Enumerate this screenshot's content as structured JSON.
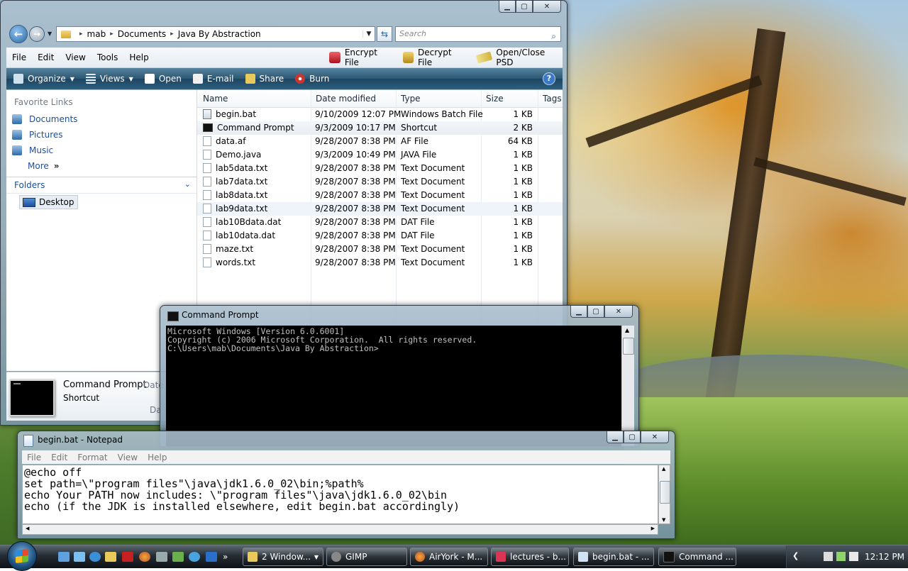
{
  "explorer": {
    "breadcrumb": [
      "mab",
      "Documents",
      "Java By Abstraction"
    ],
    "search_placeholder": "Search",
    "menu": [
      "File",
      "Edit",
      "View",
      "Tools",
      "Help"
    ],
    "tools": [
      "Encrypt File",
      "Decrypt File",
      "Open/Close PSD"
    ],
    "commands": [
      "Organize",
      "Views",
      "Open",
      "E-mail",
      "Share",
      "Burn"
    ],
    "favorites_title": "Favorite Links",
    "favorites": [
      "Documents",
      "Pictures",
      "Music"
    ],
    "more_label": "More",
    "more_glyph": "»",
    "folders_label": "Folders",
    "tree_item": "Desktop",
    "columns": [
      "Name",
      "Date modified",
      "Type",
      "Size",
      "Tags"
    ],
    "files": [
      {
        "name": "begin.bat",
        "date": "9/10/2009 12:07 PM",
        "type": "Windows Batch File",
        "size": "1 KB"
      },
      {
        "name": "Command Prompt",
        "date": "9/3/2009 10:17 PM",
        "type": "Shortcut",
        "size": "2 KB"
      },
      {
        "name": "data.af",
        "date": "9/28/2007 8:38 PM",
        "type": "AF File",
        "size": "64 KB"
      },
      {
        "name": "Demo.java",
        "date": "9/3/2009 10:49 PM",
        "type": "JAVA File",
        "size": "1 KB"
      },
      {
        "name": "lab5data.txt",
        "date": "9/28/2007 8:38 PM",
        "type": "Text Document",
        "size": "1 KB"
      },
      {
        "name": "lab7data.txt",
        "date": "9/28/2007 8:38 PM",
        "type": "Text Document",
        "size": "1 KB"
      },
      {
        "name": "lab8data.txt",
        "date": "9/28/2007 8:38 PM",
        "type": "Text Document",
        "size": "1 KB"
      },
      {
        "name": "lab9data.txt",
        "date": "9/28/2007 8:38 PM",
        "type": "Text Document",
        "size": "1 KB"
      },
      {
        "name": "lab10Bdata.dat",
        "date": "9/28/2007 8:38 PM",
        "type": "DAT File",
        "size": "1 KB"
      },
      {
        "name": "lab10data.dat",
        "date": "9/28/2007 8:38 PM",
        "type": "DAT File",
        "size": "1 KB"
      },
      {
        "name": "maze.txt",
        "date": "9/28/2007 8:38 PM",
        "type": "Text Document",
        "size": "1 KB"
      },
      {
        "name": "words.txt",
        "date": "9/28/2007 8:38 PM",
        "type": "Text Document",
        "size": "1 KB"
      }
    ],
    "details": {
      "name": "Command Prompt",
      "type": "Shortcut",
      "label1": "Date",
      "label2": "Da"
    }
  },
  "cmd": {
    "title": "Command Prompt",
    "lines": [
      "Microsoft Windows [Version 6.0.6001]",
      "Copyright (c) 2006 Microsoft Corporation.  All rights reserved.",
      "",
      "C:\\Users\\mab\\Documents\\Java By Abstraction>"
    ]
  },
  "notepad": {
    "title": "begin.bat - Notepad",
    "menu": [
      "File",
      "Edit",
      "Format",
      "View",
      "Help"
    ],
    "lines": [
      "@echo off",
      "set path=\\\"program files\"\\java\\jdk1.6.0_02\\bin;%path%",
      "echo Your PATH now includes: \\\"program files\"\\java\\jdk1.6.0_02\\bin",
      "echo (if the JDK is installed elsewhere, edit begin.bat accordingly)"
    ]
  },
  "taskbar": {
    "tasks": [
      "2 Window...",
      "GIMP",
      "AirYork - M...",
      "lectures - b...",
      "begin.bat - ...",
      "Command ..."
    ],
    "clock": "12:12 PM"
  },
  "icons": {
    "back": "back-arrow-icon",
    "forward": "forward-arrow-icon",
    "refresh": "refresh-icon",
    "search": "search-icon",
    "help": "help-icon",
    "start": "windows-start-icon"
  },
  "colors": {
    "link_blue": "#1a4fa0",
    "cmdbar_dark": "#1d4561",
    "console_bg": "#000000",
    "console_fg": "#c0c0c0"
  }
}
